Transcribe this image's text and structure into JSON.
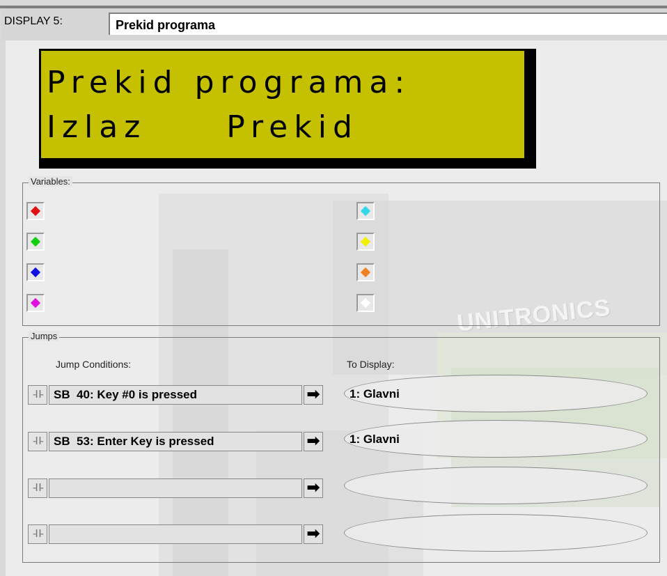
{
  "display": {
    "label": "DISPLAY 5:",
    "name": "Prekid programa"
  },
  "lcd": {
    "line1": "Prekid programa:",
    "line2": "Izlaz     Prekid",
    "background": "#c5c000"
  },
  "variables": {
    "title": "Variables:",
    "items": [
      {
        "icon": "red-diamond-icon",
        "color": "#e01010"
      },
      {
        "icon": "green-diamond-icon",
        "color": "#10d010"
      },
      {
        "icon": "blue-diamond-icon",
        "color": "#1010e0"
      },
      {
        "icon": "magenta-diamond-icon",
        "color": "#e010e0"
      },
      {
        "icon": "cyan-diamond-icon",
        "color": "#30d8e8"
      },
      {
        "icon": "yellow-diamond-icon",
        "color": "#f0f000"
      },
      {
        "icon": "orange-diamond-icon",
        "color": "#f08020"
      },
      {
        "icon": "white-diamond-icon",
        "color": "#ffffff"
      }
    ]
  },
  "jumps": {
    "title": "Jumps",
    "conditions_label": "Jump Conditions:",
    "to_display_label": "To Display:",
    "contact_symbol": "-I I-",
    "arrow_symbol": "➡",
    "rows": [
      {
        "condition": "SB  40: Key #0 is pressed",
        "target": "1: Glavni"
      },
      {
        "condition": "SB  53: Enter Key is pressed",
        "target": "1: Glavni"
      },
      {
        "condition": "",
        "target": ""
      },
      {
        "condition": "",
        "target": ""
      }
    ]
  },
  "watermark": "UNITRONICS"
}
